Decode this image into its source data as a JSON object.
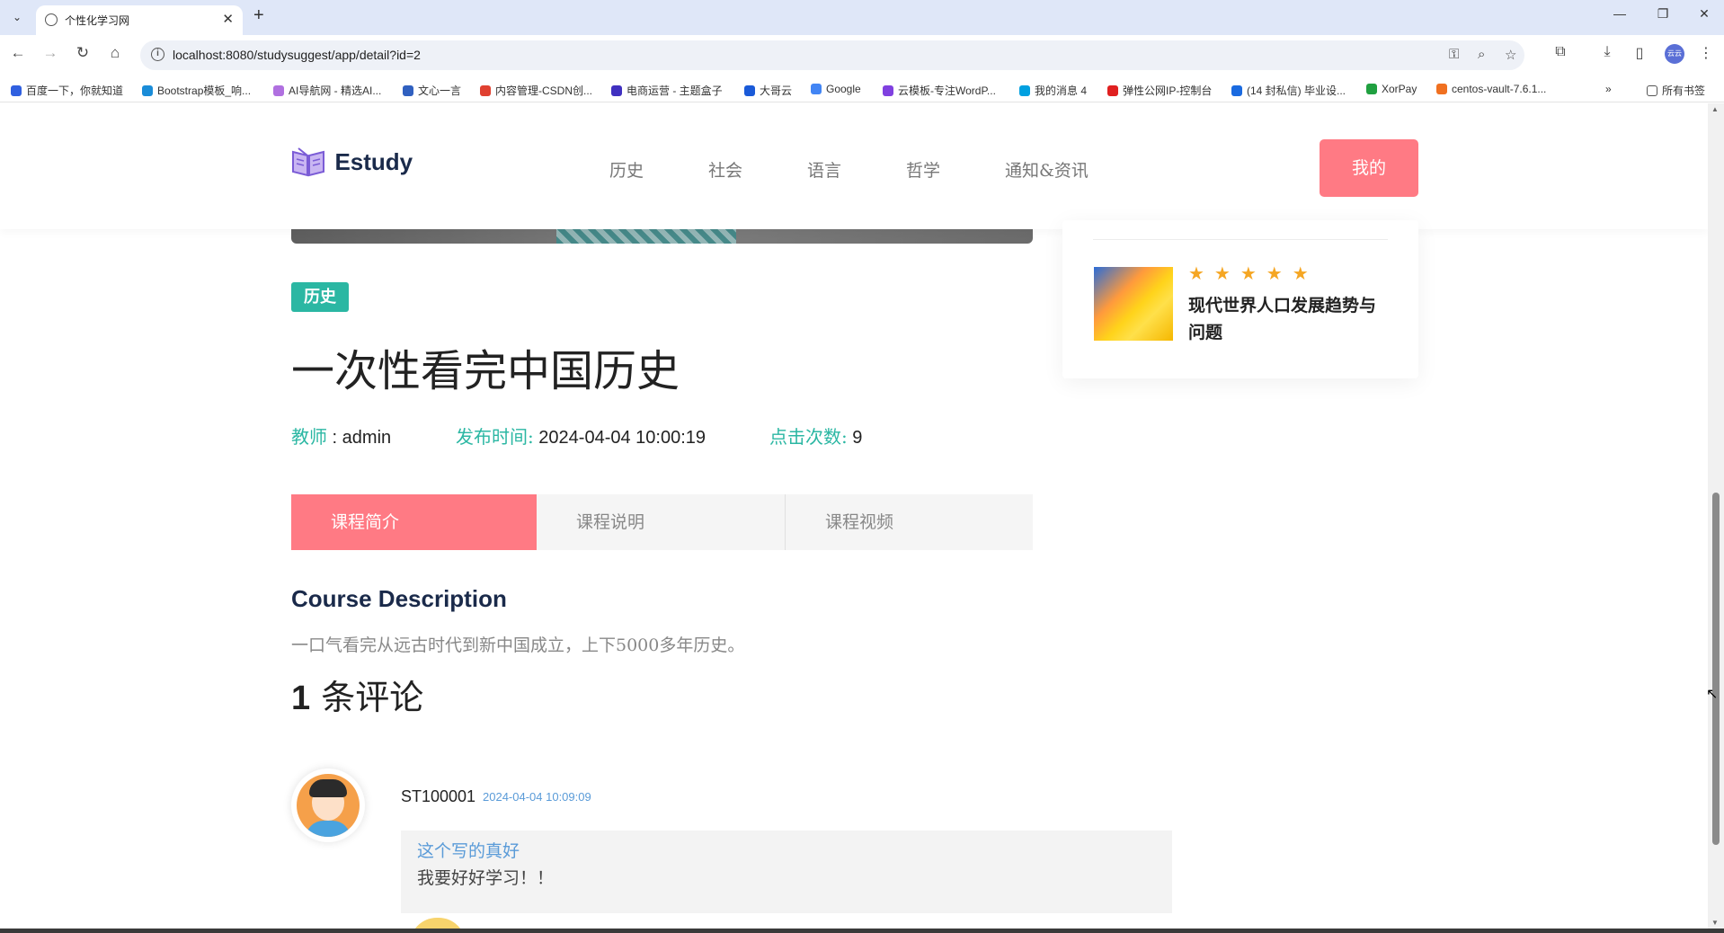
{
  "browser": {
    "tab_title": "个性化学习网",
    "url": "localhost:8080/studysuggest/app/detail?id=2",
    "profile_label": "云云",
    "bookmarks": [
      {
        "label": "百度一下，你就知道",
        "color": "#3060e0"
      },
      {
        "label": "Bootstrap模板_响...",
        "color": "#1a8cd8"
      },
      {
        "label": "AI导航网 - 精选AI...",
        "color": "#b070e0"
      },
      {
        "label": "文心一言",
        "color": "#3060c0"
      },
      {
        "label": "内容管理-CSDN创...",
        "color": "#e04030"
      },
      {
        "label": "电商运营 - 主题盒子",
        "color": "#4030c0"
      },
      {
        "label": "大哥云",
        "color": "#1a5ad8"
      },
      {
        "label": "Google",
        "color": "#4285f4"
      },
      {
        "label": "云模板-专注WordP...",
        "color": "#8040e0"
      },
      {
        "label": "我的消息 4",
        "color": "#00a0e0"
      },
      {
        "label": "弹性公网IP-控制台",
        "color": "#e02020"
      },
      {
        "label": "(14 封私信) 毕业设...",
        "color": "#1a6ae0"
      },
      {
        "label": "XorPay",
        "color": "#20a040"
      },
      {
        "label": "centos-vault-7.6.1...",
        "color": "#f07020"
      }
    ],
    "all_bookmarks": "所有书签"
  },
  "header": {
    "logo_text": "Estudy",
    "nav": [
      "历史",
      "社会",
      "语言",
      "哲学",
      "通知&资讯"
    ],
    "my_button": "我的"
  },
  "sidebar": {
    "rating": 5,
    "stars_text": "★★★★★",
    "recommend_title": "现代世界人口发展趋势与问题"
  },
  "course": {
    "category": "历史",
    "title": "一次性看完中国历史",
    "teacher_label": "教师",
    "teacher": " : admin",
    "publish_label": "发布时间:",
    "publish_time": " 2024-04-04 10:00:19",
    "clicks_label": "点击次数:",
    "clicks": " 9",
    "tabs": [
      "课程简介",
      "课程说明",
      "课程视频"
    ],
    "desc_heading": "Course Description",
    "desc_text": "一口气看完从远古时代到新中国成立，上下5000多年历史。"
  },
  "comments": {
    "count": "1",
    "label": " 条评论",
    "items": [
      {
        "user": "ST100001",
        "time": "2024-04-04 10:09:09",
        "title": "这个写的真好",
        "body": "我要好好学习！！"
      }
    ]
  }
}
